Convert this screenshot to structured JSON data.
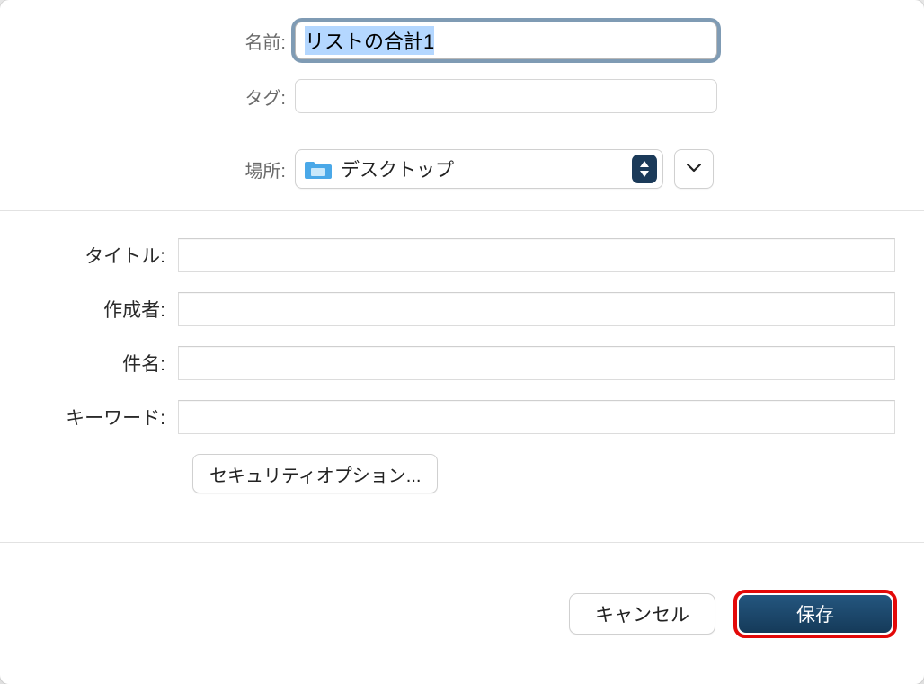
{
  "labels": {
    "name": "名前:",
    "tags": "タグ:",
    "location": "場所:",
    "title": "タイトル:",
    "author": "作成者:",
    "subject": "件名:",
    "keywords": "キーワード:"
  },
  "fields": {
    "name_value": "リストの合計1",
    "tags_value": "",
    "location_display": "デスクトップ",
    "title_value": "",
    "author_value": "",
    "subject_value": "",
    "keywords_value": ""
  },
  "buttons": {
    "security_options": "セキュリティオプション...",
    "cancel": "キャンセル",
    "save": "保存"
  }
}
